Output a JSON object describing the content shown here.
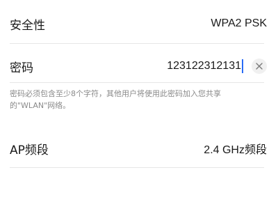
{
  "security": {
    "label": "安全性",
    "value": "WPA2 PSK"
  },
  "password": {
    "label": "密码",
    "value": "123122312131",
    "clear_icon": "close-icon"
  },
  "hint": {
    "text": "密码必须包含至少8个字符，其他用户将使用此密码加入您共享的\"WLAN\"网络。"
  },
  "ap_band": {
    "label": "AP频段",
    "value": "2.4 GHz频段"
  },
  "colors": {
    "caret": "#2a6cf6",
    "divider": "#e6e6e6",
    "hint_text": "#8a8a8a"
  }
}
